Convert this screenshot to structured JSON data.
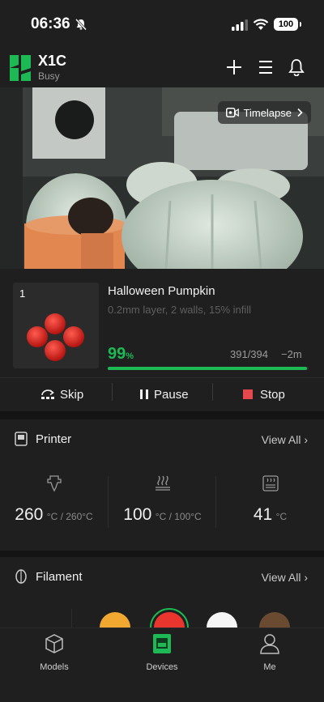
{
  "status_bar": {
    "time": "06:36",
    "battery": "100"
  },
  "header": {
    "device_name": "X1C",
    "device_status": "Busy"
  },
  "camera": {
    "timelapse_label": "Timelapse"
  },
  "job": {
    "plate_number": "1",
    "title": "Halloween Pumpkin",
    "meta": "0.2mm layer, 2 walls, 15% infill",
    "progress_percent": "99",
    "percent_symbol": "%",
    "progress_fraction": 0.99,
    "layers": "391/394",
    "remaining": "−2m",
    "actions": {
      "skip": "Skip",
      "pause": "Pause",
      "stop": "Stop"
    }
  },
  "printer": {
    "title": "Printer",
    "view_all": "View All",
    "temps": [
      {
        "value": "260",
        "unit": "°C / 260°C",
        "icon": "nozzle-icon"
      },
      {
        "value": "100",
        "unit": "°C / 100°C",
        "icon": "heatbed-icon"
      },
      {
        "value": "41",
        "unit": "°C",
        "icon": "chamber-icon"
      }
    ]
  },
  "filament": {
    "title": "Filament",
    "view_all": "View All",
    "spools": [
      "#f0a830",
      "#e8362f",
      "#f5f5f5",
      "#6b4a32"
    ]
  },
  "nav": {
    "models": "Models",
    "devices": "Devices",
    "me": "Me"
  },
  "colors": {
    "accent": "#1db954",
    "stop": "#e5484d",
    "background": "#141414",
    "card": "#1f1f1f"
  }
}
